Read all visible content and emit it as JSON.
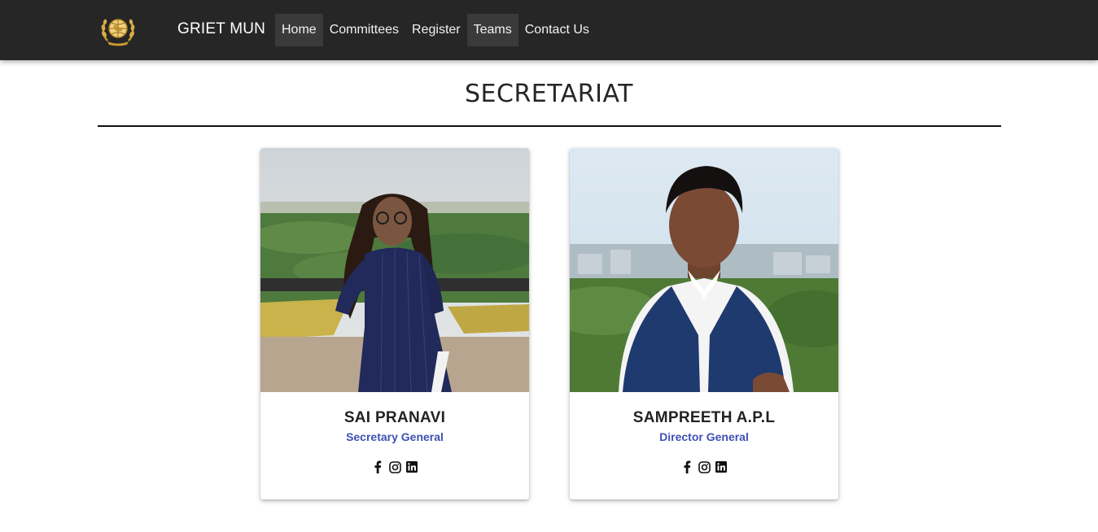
{
  "navbar": {
    "brand": "GRIET MUN",
    "links": [
      {
        "label": "Home",
        "active": true
      },
      {
        "label": "Committees",
        "active": false
      },
      {
        "label": "Register",
        "active": false
      },
      {
        "label": "Teams",
        "active": true
      },
      {
        "label": "Contact Us",
        "active": false
      }
    ],
    "logo_icon": "globe-laurel-emblem-icon"
  },
  "section": {
    "title": "SECRETARIAT"
  },
  "members": [
    {
      "name": "SAI PRANAVI",
      "role": "Secretary General",
      "socials": [
        "facebook-icon",
        "instagram-icon",
        "linkedin-icon"
      ]
    },
    {
      "name": "SAMPREETH A.P.L",
      "role": "Director General",
      "socials": [
        "facebook-icon",
        "instagram-icon",
        "linkedin-icon"
      ]
    }
  ],
  "colors": {
    "navbar_bg": "#262626",
    "active_link_bg": "#3a3a3a",
    "role_text": "#3f51b5",
    "logo_gold": "#d4a93a"
  }
}
